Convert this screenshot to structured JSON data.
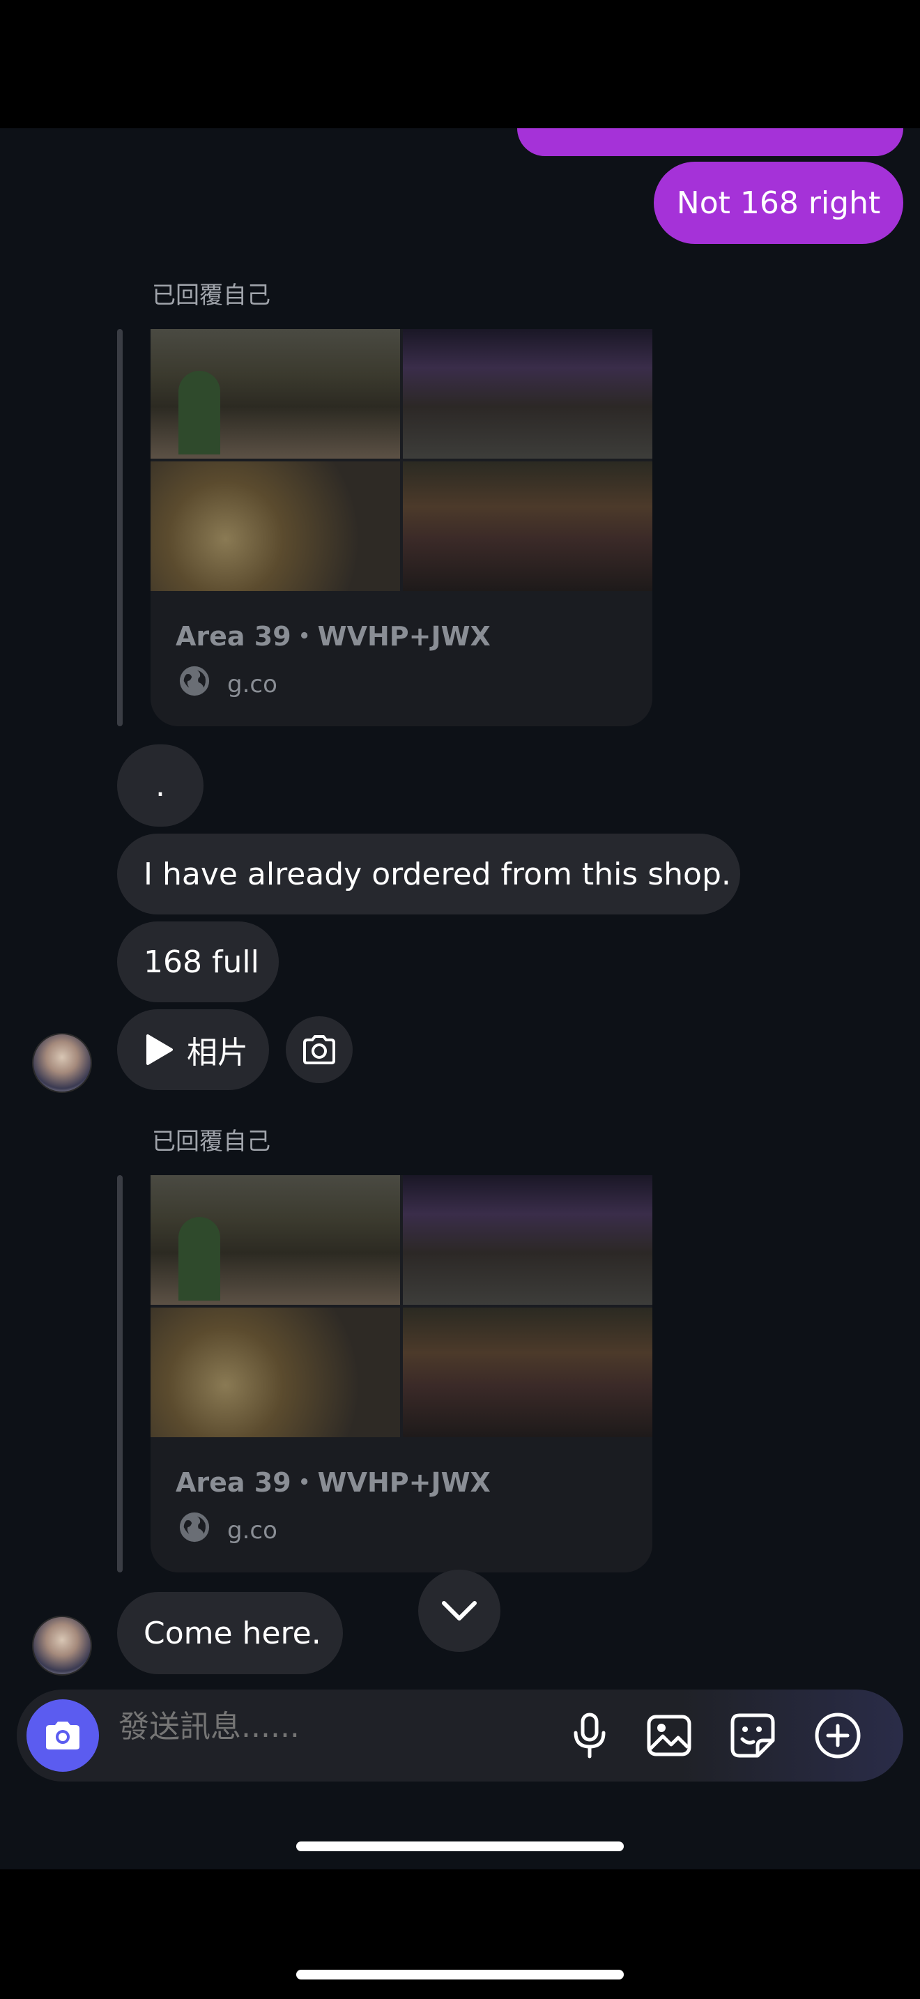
{
  "chat": {
    "outgoing": {
      "message_1": "Not 168 right"
    },
    "reply_label_1": "已回覆自己",
    "reply_label_2": "已回覆自己",
    "link_card": {
      "title": "Area 39・WVHP+JWX",
      "domain": "g.co",
      "globe_icon": "globe-icon"
    },
    "incoming": {
      "dot": ".",
      "message_ordered": "I have already ordered from this shop.",
      "message_168": "168 full",
      "photo_label": "相片",
      "come_here": "Come here."
    }
  },
  "composer": {
    "placeholder": "發送訊息......",
    "camera_icon": "camera-icon",
    "mic_icon": "microphone-icon",
    "gallery_icon": "image-icon",
    "sticker_icon": "sticker-icon",
    "plus_icon": "plus-icon"
  },
  "colors": {
    "outgoing_bubble": "#a532d8",
    "incoming_bubble": "#26282e",
    "background": "#0d1117",
    "camera_button": "#5b5cf0"
  }
}
